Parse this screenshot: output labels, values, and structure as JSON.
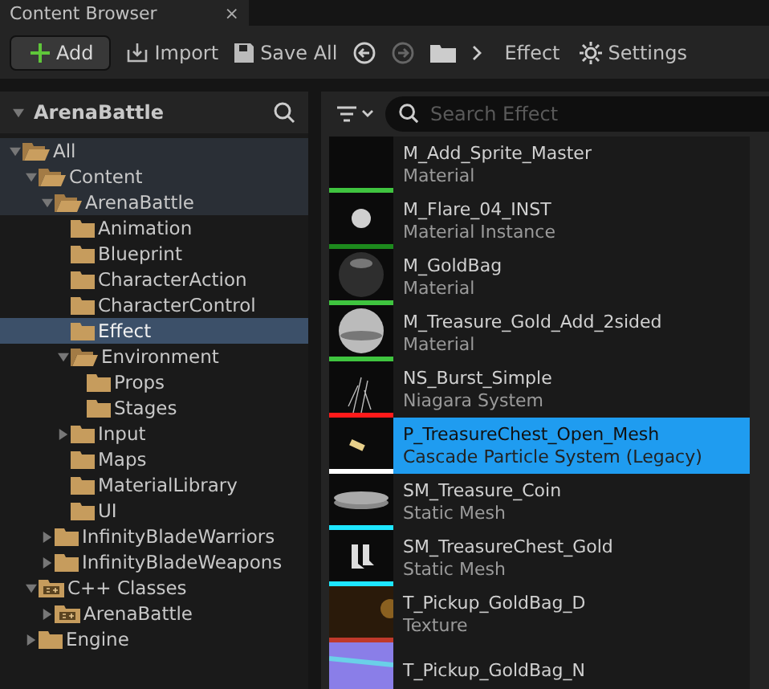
{
  "tab": {
    "title": "Content Browser",
    "close": "×"
  },
  "toolbar": {
    "add": "Add",
    "import": "Import",
    "save_all": "Save All",
    "back": {
      "disabled": false
    },
    "forward": {
      "disabled": true
    },
    "breadcrumb": "Effect",
    "settings": "Settings"
  },
  "sources": {
    "title": "ArenaBattle",
    "tree": [
      {
        "label": "All",
        "kind": "folder",
        "expanded": true,
        "selected": false,
        "in_path": true,
        "children": [
          {
            "label": "Content",
            "kind": "folder",
            "expanded": true,
            "selected": false,
            "in_path": true,
            "children": [
              {
                "label": "ArenaBattle",
                "kind": "folder",
                "expanded": true,
                "selected": false,
                "in_path": true,
                "children": [
                  {
                    "label": "Animation",
                    "kind": "folder",
                    "selected": false,
                    "in_path": false
                  },
                  {
                    "label": "Blueprint",
                    "kind": "folder",
                    "selected": false,
                    "in_path": false
                  },
                  {
                    "label": "CharacterAction",
                    "kind": "folder",
                    "selected": false,
                    "in_path": false
                  },
                  {
                    "label": "CharacterControl",
                    "kind": "folder",
                    "selected": false,
                    "in_path": false
                  },
                  {
                    "label": "Effect",
                    "kind": "folder",
                    "selected": true,
                    "in_path": false
                  },
                  {
                    "label": "Environment",
                    "kind": "folder",
                    "expanded": true,
                    "selected": false,
                    "in_path": false,
                    "children": [
                      {
                        "label": "Props",
                        "kind": "folder",
                        "selected": false,
                        "in_path": false
                      },
                      {
                        "label": "Stages",
                        "kind": "folder",
                        "selected": false,
                        "in_path": false
                      }
                    ]
                  },
                  {
                    "label": "Input",
                    "kind": "folder",
                    "expanded": false,
                    "selected": false,
                    "in_path": false
                  },
                  {
                    "label": "Maps",
                    "kind": "folder",
                    "selected": false,
                    "in_path": false
                  },
                  {
                    "label": "MaterialLibrary",
                    "kind": "folder",
                    "selected": false,
                    "in_path": false
                  },
                  {
                    "label": "UI",
                    "kind": "folder",
                    "selected": false,
                    "in_path": false
                  }
                ]
              },
              {
                "label": "InfinityBladeWarriors",
                "kind": "folder",
                "expanded": false,
                "selected": false,
                "in_path": false
              },
              {
                "label": "InfinityBladeWeapons",
                "kind": "folder",
                "expanded": false,
                "selected": false,
                "in_path": false
              }
            ]
          },
          {
            "label": "C++ Classes",
            "kind": "cpp",
            "expanded": true,
            "selected": false,
            "in_path": false,
            "children": [
              {
                "label": "ArenaBattle",
                "kind": "cpp",
                "expanded": false,
                "selected": false,
                "in_path": false
              }
            ]
          },
          {
            "label": "Engine",
            "kind": "folder",
            "expanded": false,
            "selected": false,
            "in_path": false
          }
        ]
      }
    ]
  },
  "assets": {
    "search": {
      "placeholder": "Search Effect"
    },
    "items": [
      {
        "name": "M_Add_Sprite_Master",
        "type": "Material",
        "kind": "blank",
        "color": "#3fc43f",
        "selected": false
      },
      {
        "name": "M_Flare_04_INST",
        "type": "Material Instance",
        "kind": "glow",
        "color": "#1d8a1d",
        "selected": false
      },
      {
        "name": "M_GoldBag",
        "type": "Material",
        "kind": "dark-sphere",
        "color": "#3fc43f",
        "selected": false
      },
      {
        "name": "M_Treasure_Gold_Add_2sided",
        "type": "Material",
        "kind": "light-sphere",
        "color": "#3fc43f",
        "selected": false
      },
      {
        "name": "NS_Burst_Simple",
        "type": "Niagara System",
        "kind": "sparks",
        "color": "#ff1a1a",
        "selected": false
      },
      {
        "name": "P_TreasureChest_Open_Mesh",
        "type": "Cascade Particle System (Legacy)",
        "kind": "chip",
        "color": "#ffffff",
        "selected": true
      },
      {
        "name": "SM_Treasure_Coin",
        "type": "Static Mesh",
        "kind": "disc",
        "color": "#1ee6ff",
        "selected": false
      },
      {
        "name": "SM_TreasureChest_Gold",
        "type": "Static Mesh",
        "kind": "boots",
        "color": "#1ee6ff",
        "selected": false
      },
      {
        "name": "T_Pickup_GoldBag_D",
        "type": "Texture",
        "kind": "texture",
        "color": "#c0392b",
        "selected": false
      },
      {
        "name": "T_Pickup_GoldBag_N",
        "kind": "normal",
        "selected": false
      }
    ]
  }
}
